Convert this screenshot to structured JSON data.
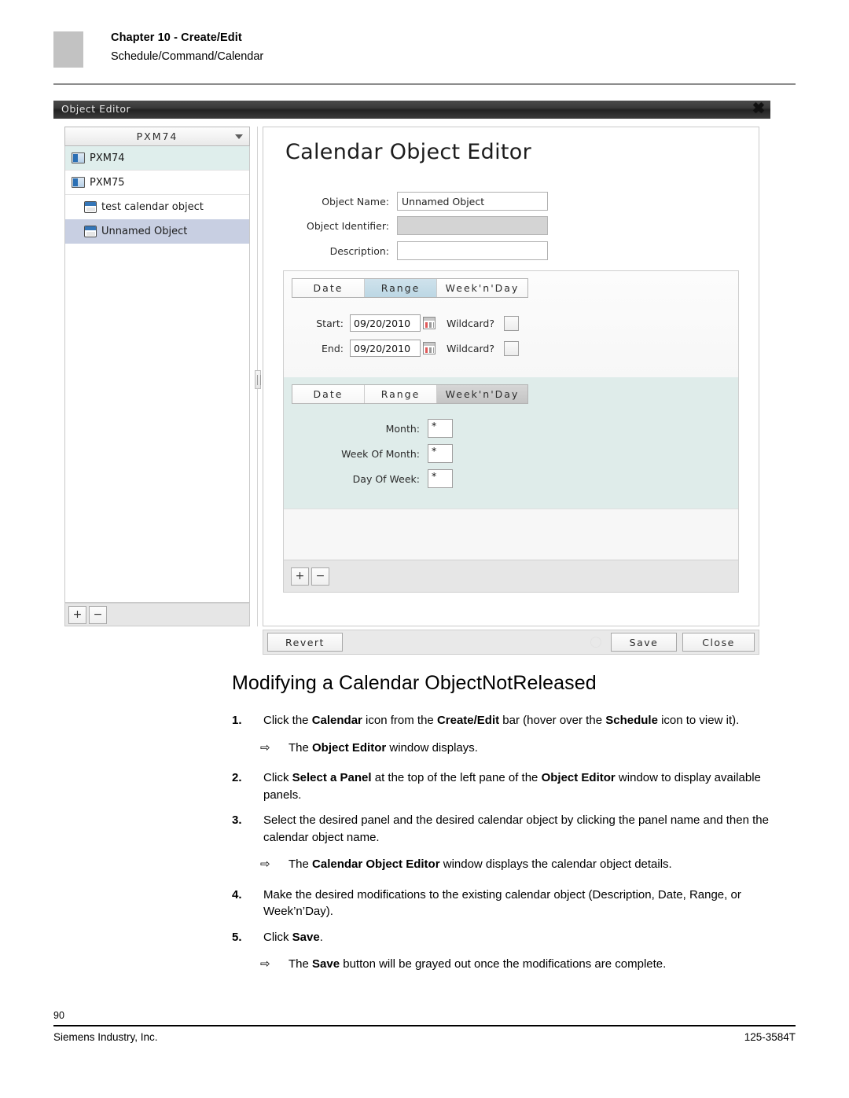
{
  "header": {
    "chapter": "Chapter 10 - Create/Edit",
    "subtitle": "Schedule/Command/Calendar"
  },
  "object_editor": {
    "window_title": "Object Editor",
    "close_icon": "✖",
    "left_pane": {
      "panel_selector_value": "PXM74",
      "tree_items": [
        {
          "label": "PXM74",
          "icon": "panel-icon",
          "level": 0,
          "state": "selected-panel"
        },
        {
          "label": "PXM75",
          "icon": "panel-icon",
          "level": 0,
          "state": "normal"
        },
        {
          "label": "test calendar object",
          "icon": "calendar-icon",
          "level": 1,
          "state": "normal"
        },
        {
          "label": "Unnamed Object",
          "icon": "calendar-icon",
          "level": 1,
          "state": "selected-object"
        }
      ],
      "add_label": "+",
      "remove_label": "−"
    },
    "right_pane": {
      "title": "Calendar Object Editor",
      "fields": [
        {
          "label": "Object Name:",
          "value": "Unnamed Object",
          "disabled": false
        },
        {
          "label": "Object Identifier:",
          "value": "",
          "disabled": true
        },
        {
          "label": "Description:",
          "value": "",
          "disabled": false
        }
      ],
      "range_section": {
        "tabs": [
          {
            "label": "Date",
            "active": false
          },
          {
            "label": "Range",
            "active": true
          },
          {
            "label": "Week'n'Day",
            "active": false
          }
        ],
        "rows": [
          {
            "label": "Start:",
            "value": "09/20/2010",
            "wildcard_label": "Wildcard?",
            "wildcard_checked": false
          },
          {
            "label": "End:",
            "value": "09/20/2010",
            "wildcard_label": "Wildcard?",
            "wildcard_checked": false
          }
        ]
      },
      "weeknday_section": {
        "tabs": [
          {
            "label": "Date",
            "active": false
          },
          {
            "label": "Range",
            "active": false
          },
          {
            "label": "Week'n'Day",
            "active": true
          }
        ],
        "rows": [
          {
            "label": "Month:",
            "value": "*"
          },
          {
            "label": "Week Of Month:",
            "value": "*"
          },
          {
            "label": "Day Of Week:",
            "value": "*"
          }
        ]
      },
      "section_toolbar": {
        "add_label": "+",
        "remove_label": "−"
      },
      "actions": {
        "revert": "Revert",
        "save": "Save",
        "close": "Close"
      }
    }
  },
  "procedure": {
    "heading": "Modifying a Calendar ObjectNotReleased",
    "arrow_glyph": "⇨",
    "steps": [
      {
        "num": "1.",
        "type": "step"
      },
      {
        "num": "",
        "type": "sub"
      },
      {
        "num": "2.",
        "type": "step"
      },
      {
        "num": "3.",
        "type": "step"
      },
      {
        "num": "",
        "type": "sub"
      },
      {
        "num": "4.",
        "type": "step"
      },
      {
        "num": "5.",
        "type": "step"
      },
      {
        "num": "",
        "type": "sub"
      }
    ],
    "step1_num": "1.",
    "step1_a": "Click the ",
    "step1_b": "Calendar",
    "step1_c": " icon from the ",
    "step1_d": "Create/Edit",
    "step1_e": " bar (hover over the ",
    "step1_f": "Schedule",
    "step1_g": " icon to view it).",
    "sub1_a": "The ",
    "sub1_b": "Object Editor",
    "sub1_c": " window displays.",
    "step2_num": "2.",
    "step2_a": "Click ",
    "step2_b": "Select a Panel",
    "step2_c": " at the top of the left pane of the ",
    "step2_d": "Object Editor",
    "step2_e": " window to display available panels.",
    "step3_num": "3.",
    "step3_a": "Select the desired panel and the desired calendar object by clicking the panel name and then the calendar object name.",
    "sub2_a": "The ",
    "sub2_b": "Calendar Object Editor",
    "sub2_c": " window displays the calendar object details.",
    "step4_num": "4.",
    "step4_a": "Make the desired modifications to the existing calendar object (Description, Date, Range, or Week’n’Day).",
    "step5_num": "5.",
    "step5_a": "Click ",
    "step5_b": "Save",
    "step5_c": ".",
    "sub3_a": "The ",
    "sub3_b": "Save",
    "sub3_c": " button will be grayed out once the modifications are complete."
  },
  "footer": {
    "page_number": "90",
    "company": "Siemens Industry, Inc.",
    "doc_number": "125-3584T"
  }
}
